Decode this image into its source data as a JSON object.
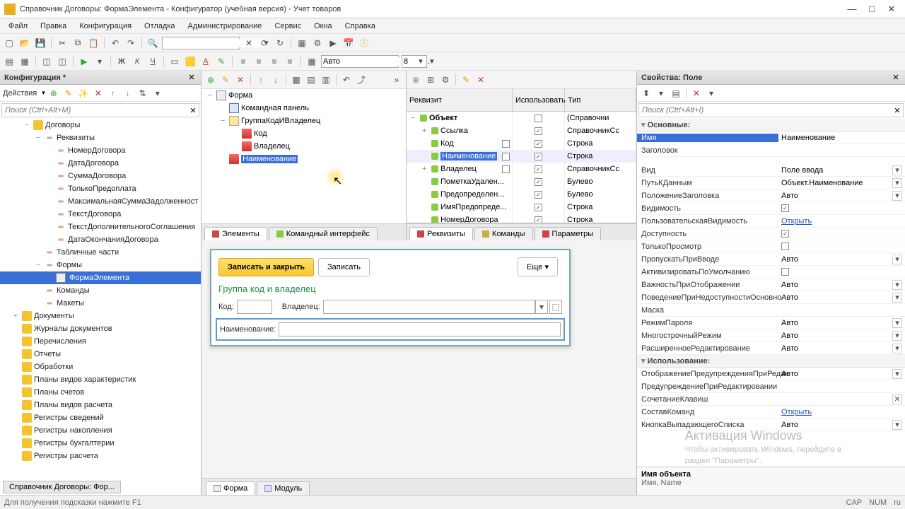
{
  "window": {
    "title": "Справочник Договоры: ФормаЭлемента - Конфигуратор (учебная версия) - Учет товаров"
  },
  "menu": [
    "Файл",
    "Правка",
    "Конфигурация",
    "Отладка",
    "Администрирование",
    "Сервис",
    "Окна",
    "Справка"
  ],
  "toolbar2": {
    "font": "Авто",
    "size": "8"
  },
  "leftPanel": {
    "title": "Конфигурация *",
    "actions": "Действия",
    "searchPh": "Поиск (Ctrl+Alt+M)"
  },
  "cfgTree": [
    {
      "d": 2,
      "exp": "−",
      "ico": "yel",
      "t": "Договоры"
    },
    {
      "d": 3,
      "exp": "−",
      "ico": "bar",
      "t": "Реквизиты"
    },
    {
      "d": 4,
      "ico": "bar",
      "t": "НомерДоговора"
    },
    {
      "d": 4,
      "ico": "bar",
      "t": "ДатаДоговора"
    },
    {
      "d": 4,
      "ico": "bar",
      "t": "СуммаДоговора"
    },
    {
      "d": 4,
      "ico": "bar",
      "t": "ТолькоПредоплата"
    },
    {
      "d": 4,
      "ico": "bar",
      "t": "МаксимальнаяСуммаЗадолженност"
    },
    {
      "d": 4,
      "ico": "bar",
      "t": "ТекстДоговора"
    },
    {
      "d": 4,
      "ico": "bar",
      "t": "ТекстДополнительногоСоглашения"
    },
    {
      "d": 4,
      "ico": "bar",
      "t": "ДатаОкончанияДоговора"
    },
    {
      "d": 3,
      "exp": "",
      "ico": "bar",
      "t": "Табличные части"
    },
    {
      "d": 3,
      "exp": "−",
      "ico": "bar",
      "t": "Формы"
    },
    {
      "d": 4,
      "ico": "form",
      "t": "ФормаЭлемента",
      "sel": true
    },
    {
      "d": 3,
      "ico": "bar",
      "t": "Команды"
    },
    {
      "d": 3,
      "ico": "bar",
      "t": "Макеты"
    },
    {
      "d": 1,
      "exp": "+",
      "ico": "yel",
      "t": "Документы"
    },
    {
      "d": 1,
      "ico": "yel",
      "t": "Журналы документов"
    },
    {
      "d": 1,
      "ico": "yel",
      "t": "Перечисления"
    },
    {
      "d": 1,
      "ico": "yel",
      "t": "Отчеты"
    },
    {
      "d": 1,
      "ico": "yel",
      "t": "Обработки"
    },
    {
      "d": 1,
      "ico": "yel",
      "t": "Планы видов характеристик"
    },
    {
      "d": 1,
      "ico": "yel",
      "t": "Планы счетов"
    },
    {
      "d": 1,
      "ico": "yel",
      "t": "Планы видов расчета"
    },
    {
      "d": 1,
      "ico": "yel",
      "t": "Регистры сведений"
    },
    {
      "d": 1,
      "ico": "yel",
      "t": "Регистры накопления"
    },
    {
      "d": 1,
      "ico": "yel",
      "t": "Регистры бухгалтерии"
    },
    {
      "d": 1,
      "ico": "yel",
      "t": "Регистры расчета"
    }
  ],
  "formTree": [
    {
      "d": 0,
      "exp": "−",
      "ico": "form",
      "t": "Форма"
    },
    {
      "d": 1,
      "ico": "cmd",
      "t": "Командная панель"
    },
    {
      "d": 1,
      "exp": "−",
      "ico": "grp",
      "t": "ГруппаКодИВладелец"
    },
    {
      "d": 2,
      "ico": "fld",
      "t": "Код"
    },
    {
      "d": 2,
      "ico": "fld",
      "t": "Владелец"
    },
    {
      "d": 1,
      "ico": "fld",
      "t": "Наименование",
      "sel": true
    }
  ],
  "formTabs": {
    "elements": "Элементы",
    "cmdif": "Командный интерфейс"
  },
  "reqHdr": {
    "c1": "Реквизит",
    "c2": "Использовать",
    "c3": "Тип"
  },
  "reqRows": [
    {
      "exp": "−",
      "n": "Объект",
      "u": "",
      "t": "(Справочни",
      "bold": true
    },
    {
      "exp": "+",
      "n": "Ссылка",
      "u": "✓",
      "t": "СправочникСс",
      "d": 1
    },
    {
      "exp": "",
      "n": "Код",
      "u": "✓",
      "t": "Строка",
      "d": 1,
      "sq": true
    },
    {
      "exp": "",
      "n": "Наименование",
      "u": "✓",
      "t": "Строка",
      "d": 1,
      "sel": true,
      "sq": true
    },
    {
      "exp": "+",
      "n": "Владелец",
      "u": "✓",
      "t": "СправочникСс",
      "d": 1,
      "sq": true
    },
    {
      "exp": "",
      "n": "ПометкаУдален...",
      "u": "✓",
      "t": "Булево",
      "d": 1
    },
    {
      "exp": "",
      "n": "Предопределен...",
      "u": "✓",
      "t": "Булево",
      "d": 1
    },
    {
      "exp": "",
      "n": "ИмяПредопреде...",
      "u": "✓",
      "t": "Строка",
      "d": 1
    },
    {
      "exp": "",
      "n": "НомерДоговора",
      "u": "✓",
      "t": "Строка",
      "d": 1
    }
  ],
  "reqTabs": {
    "r": "Реквизиты",
    "c": "Команды",
    "p": "Параметры"
  },
  "preview": {
    "saveClose": "Записать и закрыть",
    "save": "Записать",
    "more": "Еще",
    "group": "Группа код и владелец",
    "code": "Код:",
    "owner": "Владелец:",
    "name": "Наименование:"
  },
  "bottomTabs": {
    "form": "Форма",
    "module": "Модуль"
  },
  "props": {
    "title": "Свойства: Поле",
    "searchPh": "Поиск (Ctrl+Alt+I)",
    "g1": "Основные:",
    "rows1": [
      {
        "n": "Имя",
        "v": "Наименование",
        "sel": true
      },
      {
        "n": "Заголовок",
        "v": ""
      }
    ],
    "rows2": [
      {
        "n": "Вид",
        "v": "Поле ввода",
        "dd": true
      },
      {
        "n": "ПутьКДанным",
        "v": "Объект.Наименование",
        "dd": true
      },
      {
        "n": "ПоложениеЗаголовка",
        "v": "Авто",
        "dd": true
      },
      {
        "n": "Видимость",
        "v": "",
        "chk": true,
        "checked": true
      },
      {
        "n": "ПользовательскаяВидимость",
        "v": "Открыть",
        "link": true
      },
      {
        "n": "Доступность",
        "v": "",
        "chk": true,
        "checked": true
      },
      {
        "n": "ТолькоПросмотр",
        "v": "",
        "chk": true,
        "checked": false
      },
      {
        "n": "ПропускатьПриВводе",
        "v": "Авто",
        "dd": true
      },
      {
        "n": "АктивизироватьПоУмолчанию",
        "v": "",
        "chk": true,
        "checked": false
      },
      {
        "n": "ВажностьПриОтображении",
        "v": "Авто",
        "dd": true
      },
      {
        "n": "ПоведениеПриНедоступностиОсновно",
        "v": "Авто",
        "dd": true
      },
      {
        "n": "Маска",
        "v": ""
      },
      {
        "n": "РежимПароля",
        "v": "Авто",
        "dd": true
      },
      {
        "n": "МногострочныйРежим",
        "v": "Авто",
        "dd": true
      },
      {
        "n": "РасширенноеРедактирование",
        "v": "Авто",
        "dd": true
      }
    ],
    "g2": "Использование:",
    "rows3": [
      {
        "n": "ОтображениеПредупрежденияПриРедак",
        "v": "Авто",
        "dd": true
      },
      {
        "n": "ПредупреждениеПриРедактировании",
        "v": ""
      },
      {
        "n": "СочетаниеКлавиш",
        "v": "",
        "x": true
      },
      {
        "n": "СоставКоманд",
        "v": "Открыть",
        "link": true
      },
      {
        "n": "КнопкаВыпадающегоСписка",
        "v": "Авто",
        "dd": true
      }
    ],
    "footer1": "Имя объекта",
    "footer2": "Имя, Name"
  },
  "watermark": {
    "l1": "Активация Windows",
    "l2": "Чтобы активировать Windows, перейдите в",
    "l3": "раздел \"Параметры\"."
  },
  "status": {
    "hint": "Для получения подсказки нажмите F1",
    "cap": "CAP",
    "num": "NUM",
    "lang": "ru"
  },
  "docTab": "Справочник Договоры: Фор..."
}
